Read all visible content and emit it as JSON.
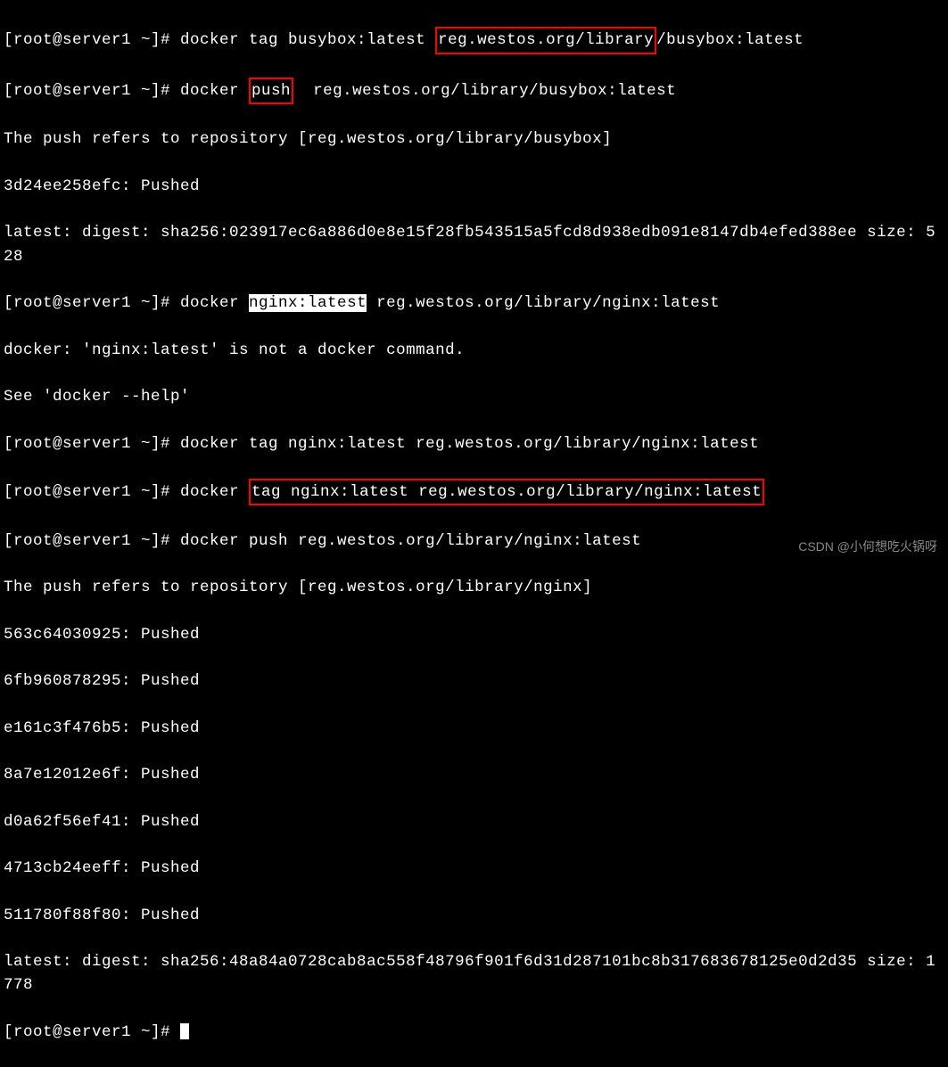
{
  "lines": {
    "l1a": "[root@server1 ~]# docker tag busybox:latest ",
    "l1b": "reg.westos.org/library",
    "l1c": "/busybox:latest",
    "l2a": "[root@server1 ~]# docker ",
    "l2b": "push",
    "l2c": "  reg.westos.org/library/busybox:latest",
    "l3": "The push refers to repository [reg.westos.org/library/busybox]",
    "l4": "3d24ee258efc: Pushed",
    "l5": "latest: digest: sha256:023917ec6a886d0e8e15f28fb543515a5fcd8d938edb091e8147db4efed388ee size: 528",
    "l6a": "[root@server1 ~]# docker ",
    "l6b": "nginx:latest",
    "l6c": " reg.westos.org/library/nginx:latest",
    "l7": "docker: 'nginx:latest' is not a docker command.",
    "l8": "See 'docker --help'",
    "l9": "[root@server1 ~]# docker tag nginx:latest reg.westos.org/library/nginx:latest",
    "l10a": "[root@server1 ~]# docker ",
    "l10b": "tag nginx:latest reg.westos.org/library/nginx:latest",
    "l11": "[root@server1 ~]# docker push reg.westos.org/library/nginx:latest",
    "l12": "The push refers to repository [reg.westos.org/library/nginx]",
    "l13": "563c64030925: Pushed",
    "l14": "6fb960878295: Pushed",
    "l15": "e161c3f476b5: Pushed",
    "l16": "8a7e12012e6f: Pushed",
    "l17": "d0a62f56ef41: Pushed",
    "l18": "4713cb24eeff: Pushed",
    "l19": "511780f88f80: Pushed",
    "l20": "latest: digest: sha256:48a84a0728cab8ac558f48796f901f6d31d287101bc8b317683678125e0d2d35 size: 1778",
    "l21": "[root@server1 ~]# "
  },
  "watermark": "CSDN @小何想吃火锅呀"
}
